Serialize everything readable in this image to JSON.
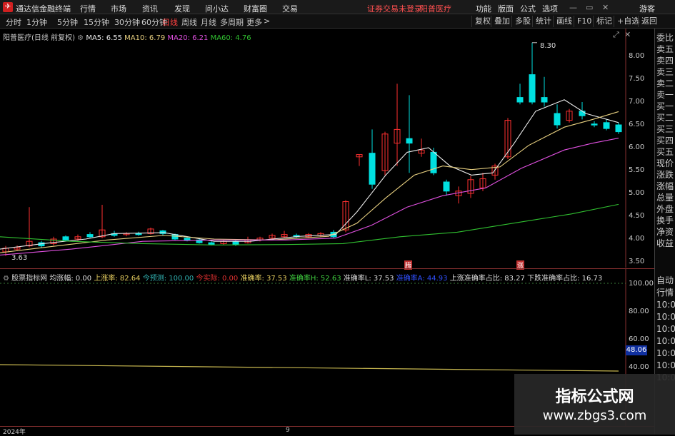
{
  "app": {
    "title": "通达信金融终端"
  },
  "menu": [
    "行情",
    "市场",
    "资讯",
    "发现",
    "问小达",
    "财富圈",
    "交易"
  ],
  "alert": {
    "login": "证券交易未登录",
    "stock": "阳普医疗"
  },
  "menu_right": [
    "功能",
    "版面",
    "公式",
    "选项"
  ],
  "guest": "游客",
  "periods": [
    "分时",
    "1分钟",
    "5分钟",
    "15分钟",
    "30分钟",
    "60分钟",
    "日线",
    "周线",
    "月线",
    "多周期",
    "更多"
  ],
  "period_active": "日线",
  "period_more_chevron": ">",
  "toolbar_right": [
    "复权",
    "叠加",
    "多股",
    "统计",
    "画线",
    "F10",
    "标记",
    "+自选",
    "返回"
  ],
  "main_chart": {
    "title": "阳普医疗(日线 前复权)",
    "ma": [
      {
        "label": "MA5: 6.55",
        "color": "#e8e8e8"
      },
      {
        "label": "MA10: 6.79",
        "color": "#e8d080"
      },
      {
        "label": "MA20: 6.21",
        "color": "#e050e0"
      },
      {
        "label": "MA60: 4.76",
        "color": "#30c030"
      }
    ],
    "high_label": "8.30",
    "low_label": "3.63",
    "marker_labels": [
      "腾",
      "涨"
    ],
    "y_ticks": [
      "8.00",
      "7.50",
      "7.00",
      "6.50",
      "6.00",
      "5.50",
      "5.00",
      "4.50",
      "4.00",
      "3.50"
    ]
  },
  "sub_chart": {
    "title": "股票指标网",
    "fields": [
      {
        "label": "均涨幅: 0.00",
        "color": "#dddddd"
      },
      {
        "label": "上涨率: 82.64",
        "color": "#e8d060"
      },
      {
        "label": "今预测: 100.00",
        "color": "#30b0b0"
      },
      {
        "label": "今实际: 0.00",
        "color": "#e03030"
      },
      {
        "label": "准确率: 37.53",
        "color": "#e8d060"
      },
      {
        "label": "准确率H: 52.63",
        "color": "#40d040"
      },
      {
        "label": "准确率L: 37.53",
        "color": "#dddddd"
      },
      {
        "label": "准确率A: 44.93",
        "color": "#3050ff"
      },
      {
        "label": "上涨准确率占比: 83.27",
        "color": "#dddddd"
      },
      {
        "label": "下跌准确率占比: 16.73",
        "color": "#dddddd"
      }
    ],
    "y_ticks": [
      "100.00",
      "80.00",
      "60.00",
      "40.00"
    ],
    "value_box": "48.06"
  },
  "time_axis": {
    "labels": [
      "2024年",
      "9"
    ]
  },
  "right_panel": [
    "委比",
    "卖五",
    "卖四",
    "卖三",
    "卖二",
    "卖一",
    "买一",
    "买二",
    "买三",
    "买四",
    "买五",
    "现价",
    "涨跌",
    "涨幅",
    "总量",
    "外盘",
    "换手",
    "净资",
    "收益"
  ],
  "right_panel_lower": [
    "自动",
    "行情",
    "10:0",
    "10:0",
    "10:0",
    "10:0",
    "10:0",
    "10:0",
    "10:0"
  ],
  "watermark": {
    "line1": "指标公式网",
    "line2": "www.zbgs3.com"
  },
  "colors": {
    "up": "#ff3030",
    "down": "#00e0e0",
    "ma5": "#e8e8e8",
    "ma10": "#e8d080",
    "ma20": "#e050e0",
    "ma60": "#30c030"
  }
}
